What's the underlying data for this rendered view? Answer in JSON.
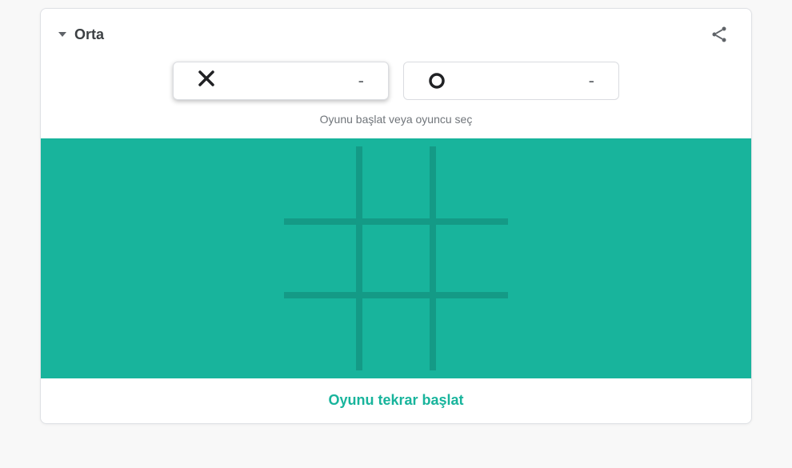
{
  "header": {
    "difficulty_label": "Orta"
  },
  "players": {
    "x": {
      "score": "-"
    },
    "o": {
      "score": "-"
    }
  },
  "hint": "Oyunu başlat veya oyuncu seç",
  "restart_label": "Oyunu tekrar başlat",
  "colors": {
    "board_bg": "#18b49c",
    "grid_line": "#149a86",
    "accent": "#18b49c"
  }
}
